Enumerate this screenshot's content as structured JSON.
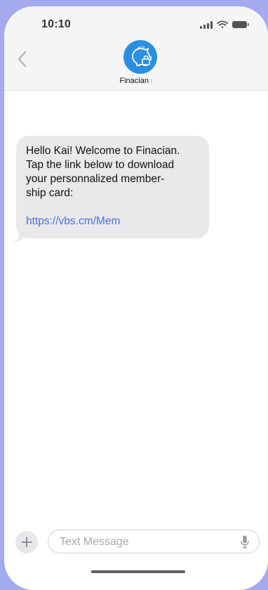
{
  "status_bar": {
    "time": "10:10",
    "icons": [
      "signal-icon",
      "wifi-icon",
      "battery-icon"
    ]
  },
  "header": {
    "back_icon": "chevron-left-icon",
    "contact_name": "Finacian",
    "contact_chevron": "›",
    "avatar_icon": "piggy-bank-lock-icon",
    "avatar_color": "#2a8fe0"
  },
  "messages": [
    {
      "direction": "incoming",
      "text": "Hello Kai! Welcome to Finacian.\nTap the link below to download\nyour personnalized member-\nship card:",
      "link": "https://vbs.cm/Mem"
    }
  ],
  "composer": {
    "plus_icon": "plus-icon",
    "placeholder": "Text Message",
    "value": "",
    "mic_icon": "microphone-icon"
  },
  "colors": {
    "background": "#a3aaee",
    "header_bg": "#f5f5f6",
    "bubble_bg": "#e9e9eb",
    "link": "#4a6ee0"
  }
}
